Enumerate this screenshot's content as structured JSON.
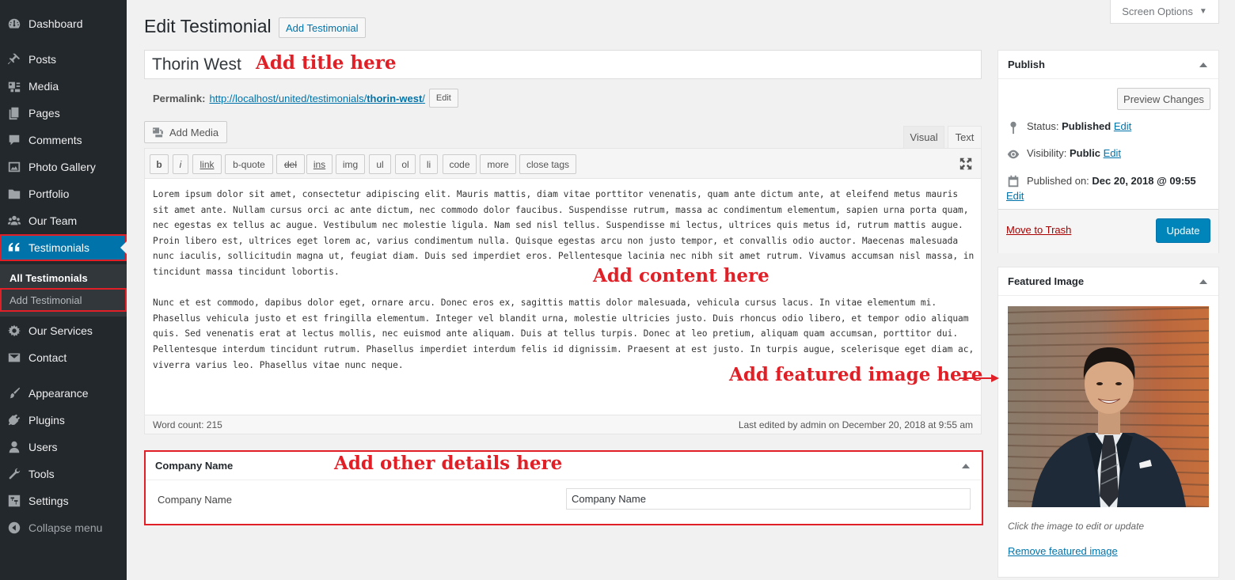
{
  "sidebar": {
    "items": [
      {
        "label": "Dashboard",
        "icon": "dashboard-icon"
      },
      {
        "label": "Posts",
        "icon": "pin-icon"
      },
      {
        "label": "Media",
        "icon": "media-icon"
      },
      {
        "label": "Pages",
        "icon": "pages-icon"
      },
      {
        "label": "Comments",
        "icon": "comment-icon"
      },
      {
        "label": "Photo Gallery",
        "icon": "gallery-icon"
      },
      {
        "label": "Portfolio",
        "icon": "folder-icon"
      },
      {
        "label": "Our Team",
        "icon": "team-icon"
      },
      {
        "label": "Testimonials",
        "icon": "quote-icon"
      },
      {
        "label": "Our Services",
        "icon": "services-icon"
      },
      {
        "label": "Contact",
        "icon": "mail-icon"
      },
      {
        "label": "Appearance",
        "icon": "brush-icon"
      },
      {
        "label": "Plugins",
        "icon": "plugin-icon"
      },
      {
        "label": "Users",
        "icon": "user-icon"
      },
      {
        "label": "Tools",
        "icon": "wrench-icon"
      },
      {
        "label": "Settings",
        "icon": "settings-icon"
      },
      {
        "label": "Collapse menu",
        "icon": "collapse-icon"
      }
    ],
    "submenu": [
      "All Testimonials",
      "Add Testimonial"
    ]
  },
  "header": {
    "screen_options": "Screen Options",
    "page_title": "Edit Testimonial",
    "add_new": "Add Testimonial"
  },
  "post": {
    "title": "Thorin West",
    "permalink_label": "Permalink:",
    "permalink_base": "http://localhost/united/testimonials/",
    "permalink_slug": "thorin-west",
    "permalink_end": "/",
    "edit_label": "Edit"
  },
  "editor": {
    "add_media": "Add Media",
    "tab_visual": "Visual",
    "tab_text": "Text",
    "quicktags": [
      "b",
      "i",
      "link",
      "b-quote",
      "del",
      "ins",
      "img",
      "ul",
      "ol",
      "li",
      "code",
      "more",
      "close tags"
    ],
    "paragraphs": [
      "Lorem ipsum dolor sit amet, consectetur adipiscing elit. Mauris mattis, diam vitae porttitor venenatis, quam ante dictum ante, at eleifend metus mauris sit amet ante. Nullam cursus orci ac ante dictum, nec commodo dolor faucibus. Suspendisse rutrum, massa ac condimentum elementum, sapien urna porta quam, nec egestas ex tellus ac augue. Vestibulum nec molestie ligula. Nam sed nisl tellus. Suspendisse mi lectus, ultrices quis metus id, rutrum mattis augue. Proin libero est, ultrices eget lorem ac, varius condimentum nulla. Quisque egestas arcu non justo tempor, et convallis odio auctor. Maecenas malesuada nunc iaculis, sollicitudin magna ut, feugiat diam. Duis sed imperdiet eros. Pellentesque lacinia nec nibh sit amet rutrum. Vivamus accumsan nisl massa, in tincidunt massa tincidunt lobortis.",
      "Nunc et est commodo, dapibus dolor eget, ornare arcu. Donec eros ex, sagittis mattis dolor malesuada, vehicula cursus lacus. In vitae elementum mi. Phasellus vehicula justo et est fringilla elementum. Integer vel blandit urna, molestie ultricies justo. Duis rhoncus odio libero, et tempor odio aliquam quis. Sed venenatis erat at lectus mollis, nec euismod ante aliquam. Duis at tellus turpis. Donec at leo pretium, aliquam quam accumsan, porttitor dui. Pellentesque interdum tincidunt rutrum. Phasellus imperdiet interdum felis id dignissim. Praesent at est justo. In turpis augue, scelerisque eget diam ac, viverra varius leo. Phasellus vitae nunc neque."
    ],
    "word_count": "Word count: 215",
    "last_edited": "Last edited by admin on December 20, 2018 at 9:55 am"
  },
  "company": {
    "box_title": "Company Name",
    "field_label": "Company Name",
    "field_value": "Company Name"
  },
  "publish": {
    "title": "Publish",
    "preview": "Preview Changes",
    "status_label": "Status:",
    "status_value": "Published",
    "visibility_label": "Visibility:",
    "visibility_value": "Public",
    "published_label": "Published on:",
    "published_value": "Dec 20, 2018 @ 09:55",
    "edit": "Edit",
    "trash": "Move to Trash",
    "update": "Update"
  },
  "featured": {
    "title": "Featured Image",
    "hint": "Click the image to edit or update",
    "remove": "Remove featured image"
  },
  "annotations": {
    "title": "Add title here",
    "content": "Add content here",
    "featured": "Add featured image here",
    "details": "Add other details here"
  },
  "colors": {
    "sidebar_bg": "#23282d",
    "active_blue": "#0073aa",
    "annotation_red": "#e01f26",
    "primary_button": "#0085ba"
  }
}
